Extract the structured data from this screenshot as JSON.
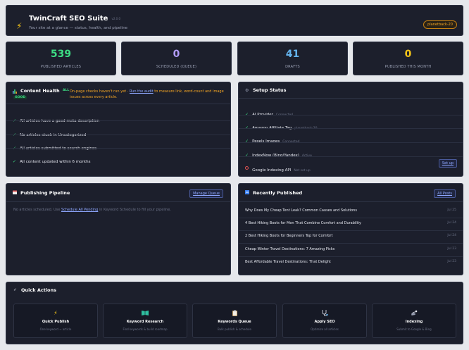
{
  "header": {
    "title": "TwinCraft SEO Suite",
    "version": "v2.0.0",
    "subtitle": "Your site at a glance — status, health, and pipeline",
    "badge": "planetback-20"
  },
  "stats": [
    {
      "value": "539",
      "label": "PUBLISHED ARTICLES",
      "color": "#3ddc84"
    },
    {
      "value": "0",
      "label": "SCHEDULED (QUEUE)",
      "color": "#b39dfa"
    },
    {
      "value": "41",
      "label": "DRAFTS",
      "color": "#63b3ed"
    },
    {
      "value": "0",
      "label": "PUBLISHED THIS MONTH",
      "color": "#f5c518"
    }
  ],
  "content_health": {
    "title": "Content Health",
    "status_top": "ALL",
    "status_bottom": "GOOD",
    "notice_pre": "On-page checks haven't run yet · ",
    "notice_link": "Run the audit",
    "notice_post": " to measure link, word-count and image issues across every article.",
    "items": [
      "All articles have a good meta description",
      "No articles stuck in Uncategorized",
      "All articles submitted to search engines",
      "All content updated within 6 months"
    ]
  },
  "setup_status": {
    "title": "Setup Status",
    "items": [
      {
        "name": "AI Provider",
        "status": "Connected"
      },
      {
        "name": "Amazon Affiliate Tag",
        "status": "planetback-20"
      },
      {
        "name": "Pexels Images",
        "status": "Connected"
      },
      {
        "name": "IndexNow (Bing/Yandex)",
        "status": "Active"
      },
      {
        "name": "Google Indexing API",
        "status": "Not set up",
        "action": "Set up"
      }
    ]
  },
  "pipeline": {
    "title": "Publishing Pipeline",
    "button": "Manage Queue",
    "empty_pre": "No articles scheduled. Use ",
    "empty_link": "Schedule All Pending",
    "empty_post": " in Keyword Schedule to fill your pipeline."
  },
  "recent": {
    "title": "Recently Published",
    "button": "All Posts",
    "items": [
      {
        "title": "Why Does My Cheap Tent Leak? Common Causes and Solutions",
        "date": "Jul 25"
      },
      {
        "title": "4 Best Hiking Boots for Men That Combine Comfort and Durability",
        "date": "Jul 24"
      },
      {
        "title": "2 Best Hiking Boots for Beginners Top for Comfort",
        "date": "Jul 24"
      },
      {
        "title": "Cheap Winter Travel Destinations: 7 Amazing Picks",
        "date": "Jul 23"
      },
      {
        "title": "Best Affordable Travel Destinations: That Delight",
        "date": "Jul 23"
      }
    ]
  },
  "quick_actions": {
    "title": "Quick Actions",
    "items": [
      {
        "icon": "lightning-icon",
        "title": "Quick Publish",
        "sub": "One keyword → article"
      },
      {
        "icon": "book-icon",
        "title": "Keyword Research",
        "sub": "Find keywords & build roadmap"
      },
      {
        "icon": "clipboard-icon",
        "title": "Keywords Queue",
        "sub": "Bulk publish & schedule"
      },
      {
        "icon": "stethoscope-icon",
        "title": "Apply SEO",
        "sub": "Optimize all articles"
      },
      {
        "icon": "satellite-icon",
        "title": "Indexing",
        "sub": "Submit to Google & Bing"
      }
    ]
  },
  "colors": {
    "accent": "#8fa8ff",
    "success": "#3ddc84",
    "warning": "#f5a623",
    "danger": "#e05252",
    "card_bg": "#1c1f2c",
    "page_bg": "#e6e8ec"
  }
}
